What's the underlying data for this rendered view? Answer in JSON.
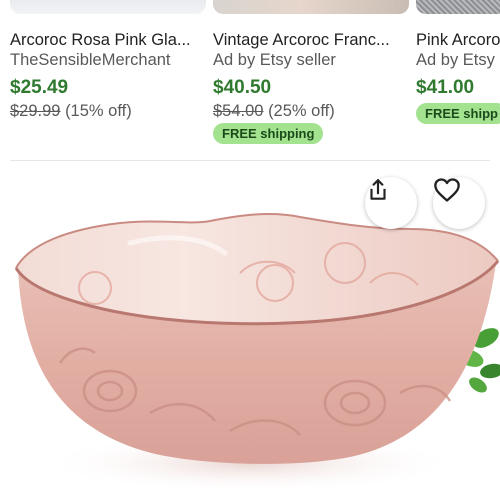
{
  "recommendations": [
    {
      "title": "Arcoroc Rosa Pink Gla...",
      "seller": "TheSensibleMerchant",
      "price": "$25.49",
      "original_price": "$29.99",
      "discount": "(15% off)",
      "shipping_badge": ""
    },
    {
      "title": "Vintage Arcoroc Franc...",
      "seller": "Ad by Etsy seller",
      "price": "$40.50",
      "original_price": "$54.00",
      "discount": "(25% off)",
      "shipping_badge": "FREE shipping"
    },
    {
      "title": "Pink Arcoroc",
      "seller": "Ad by Etsy",
      "price": "$41.00",
      "original_price": "",
      "discount": "",
      "shipping_badge": "FREE shipp"
    }
  ],
  "product_image": {
    "alt": "",
    "share_icon": "share-icon",
    "favorite_icon": "heart-outline-icon"
  },
  "colors": {
    "price_green": "#2f7a2f",
    "badge_green": "#a3e28f",
    "glass_pink": "#e7b8b0"
  }
}
